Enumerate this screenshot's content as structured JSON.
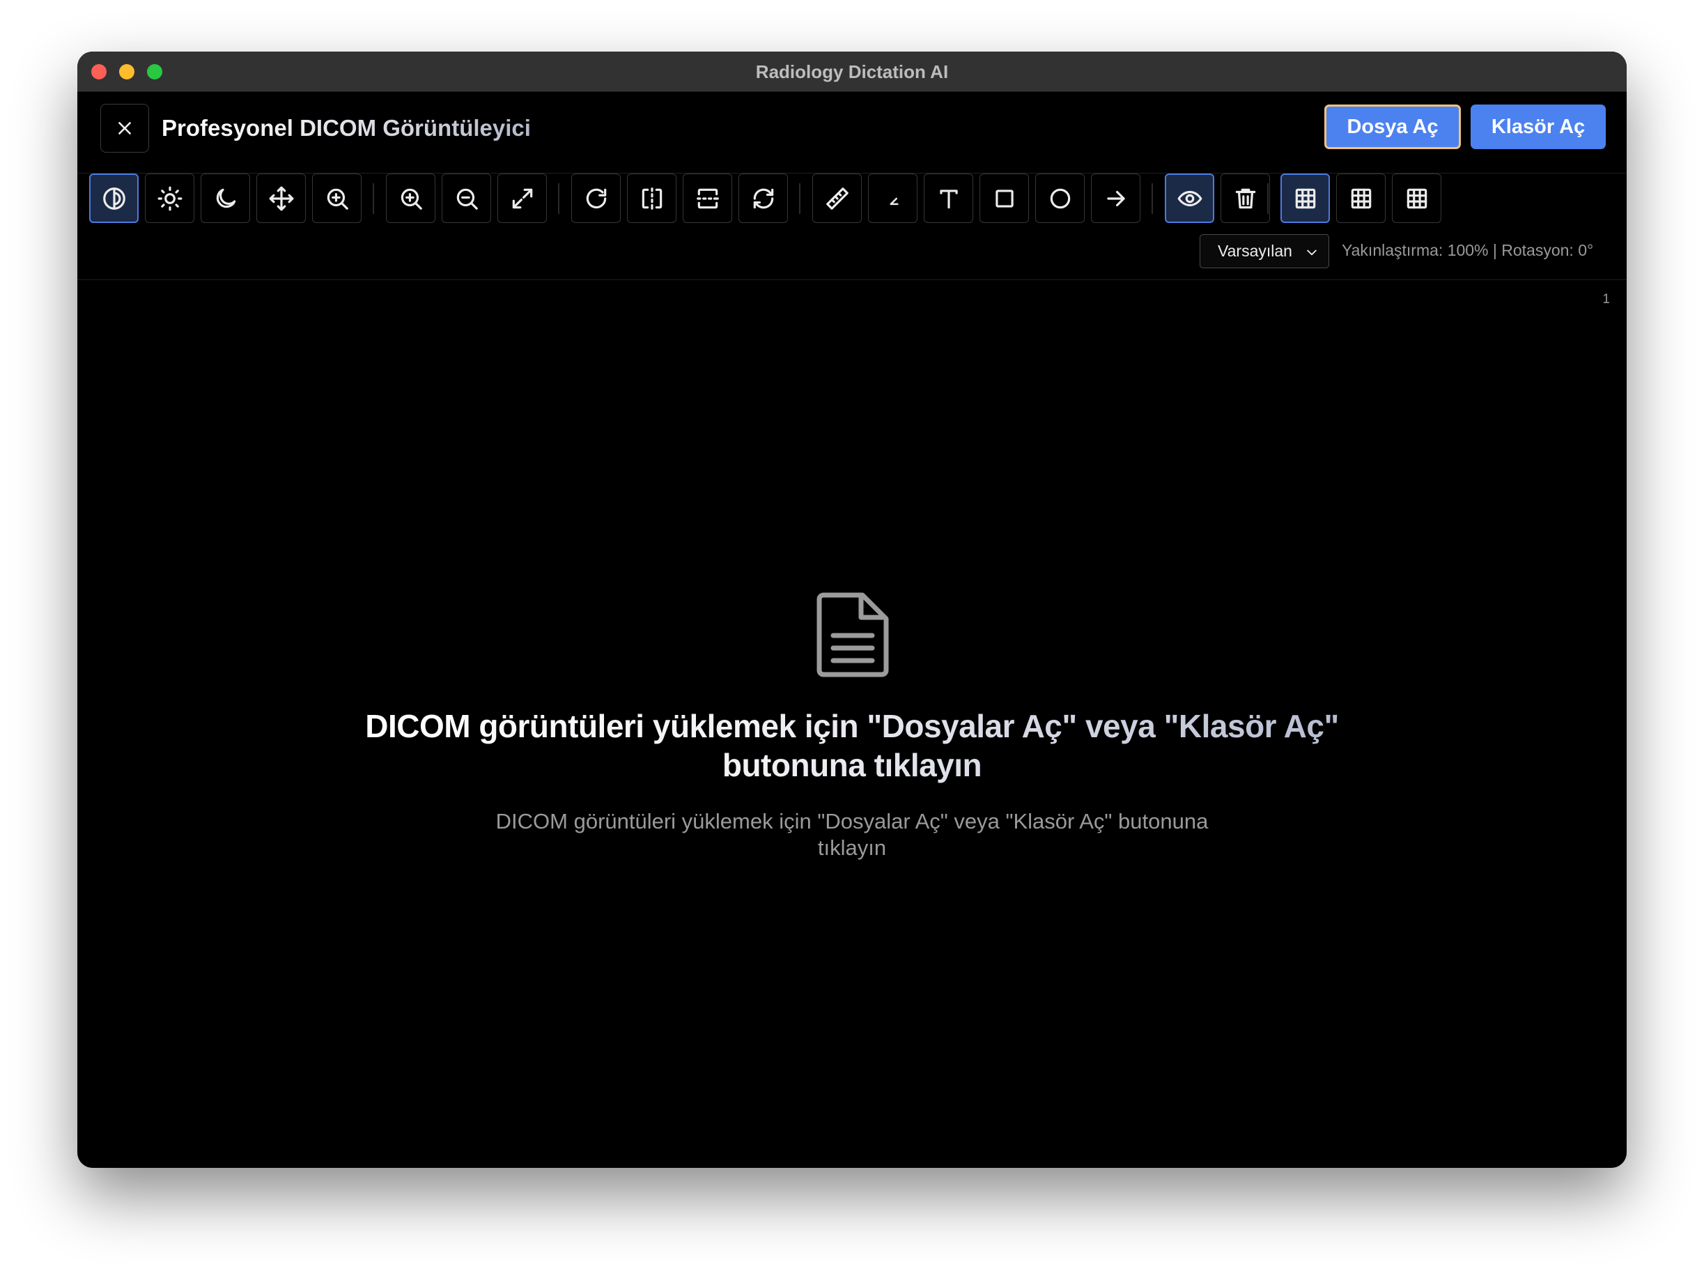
{
  "window": {
    "title": "Radiology Dictation AI"
  },
  "header": {
    "title": "Profesyonel DICOM Görüntüleyici",
    "open_file_label": "Dosya Aç",
    "open_folder_label": "Klasör Aç"
  },
  "toolbar": {
    "tools": [
      {
        "name": "window-level",
        "icon": "contrast-icon",
        "active": true
      },
      {
        "name": "brightness",
        "icon": "sun-icon",
        "active": false
      },
      {
        "name": "invert",
        "icon": "moon-icon",
        "active": false
      },
      {
        "name": "pan",
        "icon": "move-icon",
        "active": false
      },
      {
        "name": "magnify",
        "icon": "magnify-icon",
        "active": false
      },
      {
        "name": "zoom-in",
        "icon": "zoom-in-icon",
        "active": false
      },
      {
        "name": "zoom-out",
        "icon": "zoom-out-icon",
        "active": false
      },
      {
        "name": "fit",
        "icon": "expand-icon",
        "active": false
      },
      {
        "name": "rotate",
        "icon": "rotate-cw-icon",
        "active": false
      },
      {
        "name": "flip-horizontal",
        "icon": "flip-horizontal-icon",
        "active": false
      },
      {
        "name": "flip-vertical",
        "icon": "flip-vertical-icon",
        "active": false
      },
      {
        "name": "reset",
        "icon": "refresh-icon",
        "active": false
      },
      {
        "name": "length",
        "icon": "ruler-icon",
        "active": false
      },
      {
        "name": "angle",
        "icon": "angle-icon",
        "active": false
      },
      {
        "name": "text",
        "icon": "text-icon",
        "active": false
      },
      {
        "name": "rectangle",
        "icon": "rectangle-icon",
        "active": false
      },
      {
        "name": "ellipse",
        "icon": "circle-icon",
        "active": false
      },
      {
        "name": "arrow",
        "icon": "arrow-right-icon",
        "active": false
      },
      {
        "name": "toggle-annotations",
        "icon": "eye-icon",
        "active": true
      },
      {
        "name": "clear-annotations",
        "icon": "trash-icon",
        "active": false
      },
      {
        "name": "layout-1",
        "icon": "grid-icon",
        "active": true
      },
      {
        "name": "layout-2",
        "icon": "grid-icon",
        "active": false
      },
      {
        "name": "layout-3",
        "icon": "grid-icon",
        "active": false
      }
    ],
    "preset_select": {
      "value": "Varsayılan"
    },
    "zoom_info": "Yakınlaştırma: 100% | Rotasyon: 0°"
  },
  "viewport": {
    "frame_number": "1",
    "empty_state": {
      "icon": "document-icon",
      "title": "DICOM görüntüleri yüklemek için \"Dosyalar Aç\" veya \"Klasör Aç\" butonuna tıklayın",
      "subtitle": "DICOM görüntüleri yüklemek için \"Dosyalar Aç\" veya \"Klasör Aç\" butonuna tıklayın"
    }
  },
  "colors": {
    "accent": "#4c82ef",
    "focus_ring": "#f3c37a",
    "active_tool_bg": "#1b2a47",
    "background": "#000000"
  }
}
